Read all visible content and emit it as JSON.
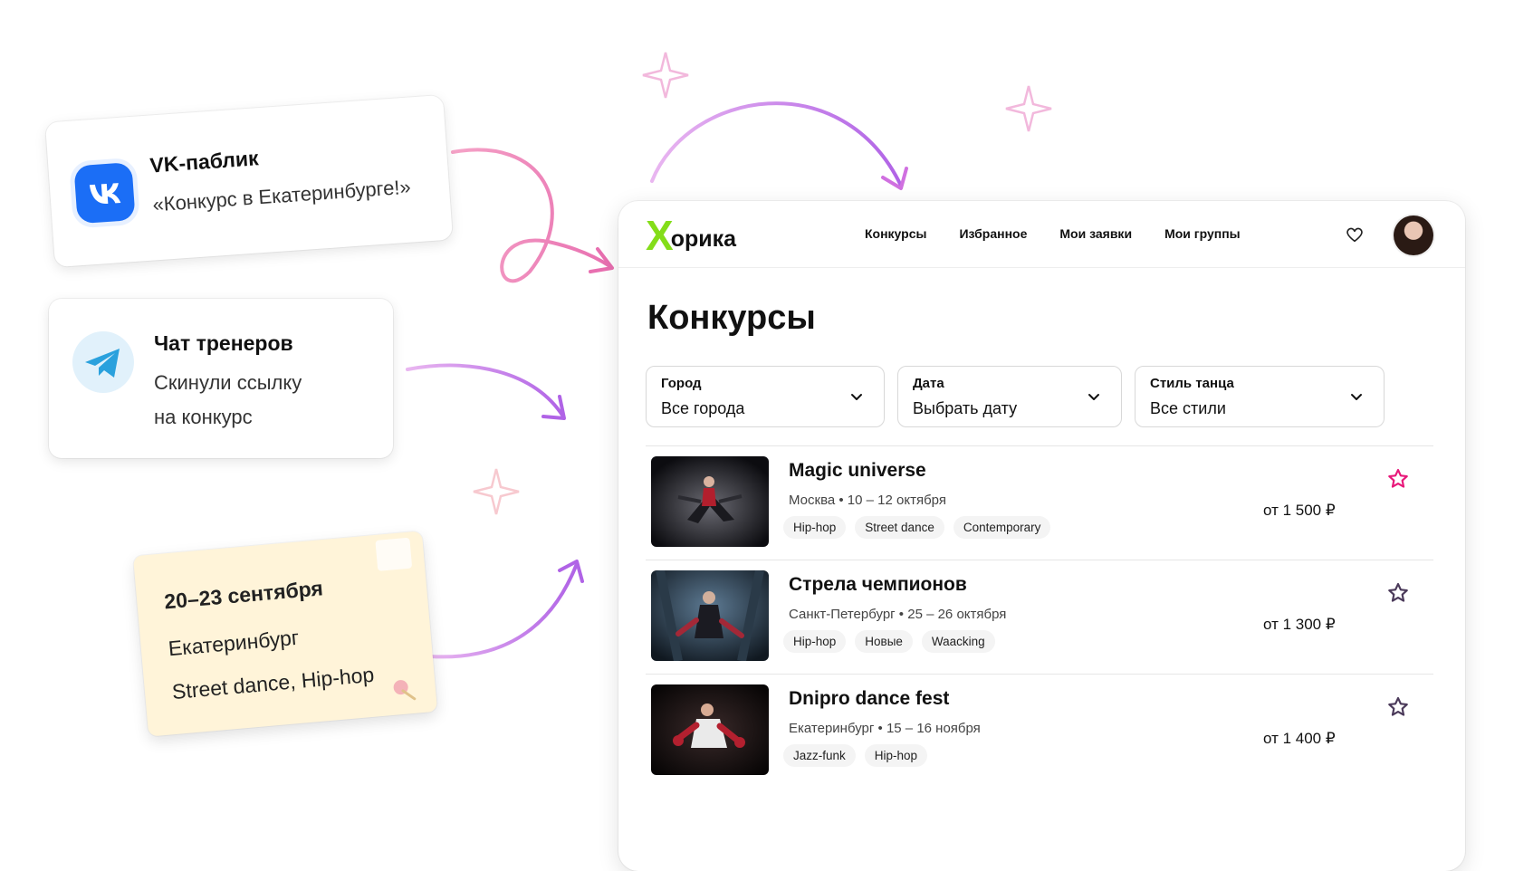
{
  "vk_card": {
    "title": "VK-паблик",
    "text": "«Конкурс в Екатеринбурге!»",
    "icon": "vk-logo-icon",
    "color": "#1b6ef6"
  },
  "tg_card": {
    "title": "Чат тренеров",
    "line1": "Скинули ссылку",
    "line2": "на конкурс",
    "icon": "telegram-logo-icon",
    "color": "#2aa1dd"
  },
  "note": {
    "dates": "20–23 сентября",
    "city": "Екатеринбург",
    "styles": "Street dance, Hip-hop"
  },
  "app": {
    "logo_x": "Х",
    "logo_rest": "орика",
    "nav": [
      "Конкурсы",
      "Избранное",
      "Мои заявки",
      "Мои группы"
    ],
    "page_title": "Конкурсы",
    "filters": [
      {
        "label": "Город",
        "value": "Все города"
      },
      {
        "label": "Дата",
        "value": "Выбрать дату"
      },
      {
        "label": "Стиль танца",
        "value": "Все стили"
      }
    ],
    "contests": [
      {
        "title": "Magic universe",
        "meta": "Москва • 10 – 12 октября",
        "tags": [
          "Hip-hop",
          "Street dance",
          "Contemporary"
        ],
        "price": "от 1 500 ₽",
        "favorite": true
      },
      {
        "title": "Стрела чемпионов",
        "meta": "Санкт-Петербург • 25 – 26 октября",
        "tags": [
          "Hip-hop",
          "Новые",
          "Waacking"
        ],
        "price": "от 1 300 ₽",
        "favorite": false
      },
      {
        "title": "Dnipro dance fest",
        "meta": "Екатеринбург • 15 – 16 ноября",
        "tags": [
          "Jazz-funk",
          "Hip-hop"
        ],
        "price": "от 1 400 ₽",
        "favorite": false
      }
    ],
    "colors": {
      "brand_green": "#84dd1a",
      "favorite_pink": "#e8197a",
      "star_outline": "#4b3a5a"
    }
  }
}
